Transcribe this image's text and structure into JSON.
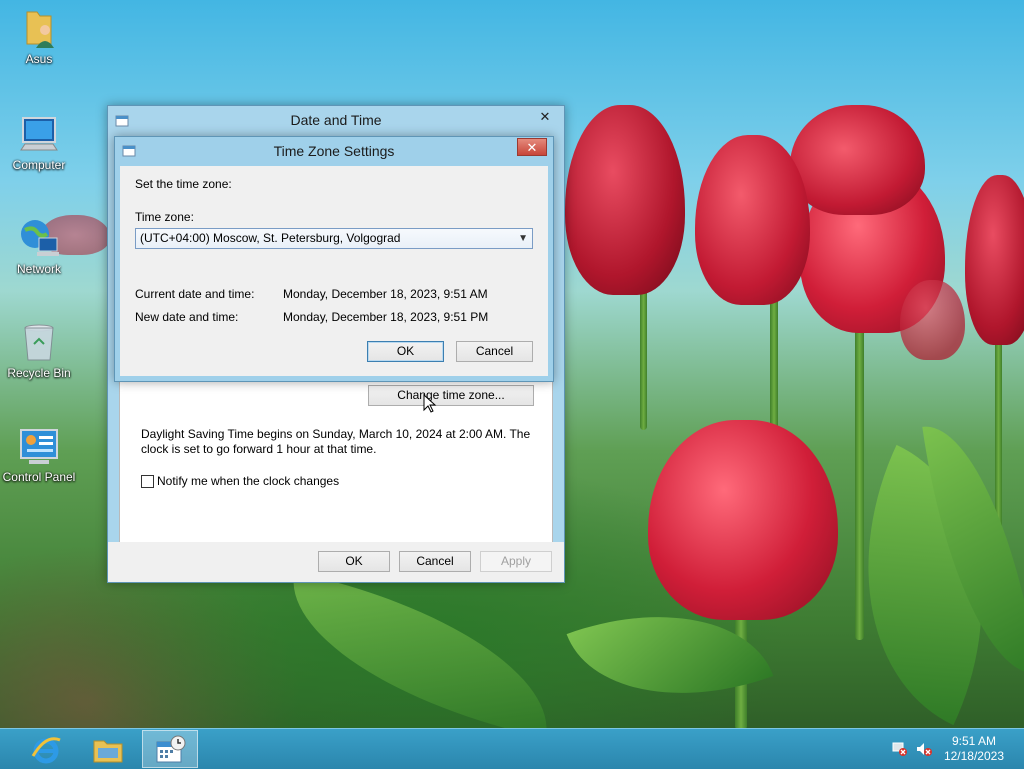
{
  "desktop": {
    "icons": [
      {
        "label": "Asus"
      },
      {
        "label": "Computer"
      },
      {
        "label": "Network"
      },
      {
        "label": "Recycle Bin"
      },
      {
        "label": "Control Panel"
      }
    ]
  },
  "date_time_window": {
    "title": "Date and Time",
    "close_glyph": "✕",
    "change_tz_button": "Change time zone...",
    "dst_line1": "Daylight Saving Time begins on Sunday, March 10, 2024 at 2:00 AM. The",
    "dst_line2": "clock is set to go forward 1 hour at that time.",
    "notify_label": "Notify me when the clock changes",
    "notify_checked": false,
    "ok_label": "OK",
    "cancel_label": "Cancel",
    "apply_label": "Apply"
  },
  "tz_dialog": {
    "title": "Time Zone Settings",
    "close_glyph": "✕",
    "set_label": "Set the time zone:",
    "tz_label": "Time zone:",
    "tz_value": "(UTC+04:00) Moscow, St. Petersburg, Volgograd",
    "current_label": "Current date and time:",
    "current_value": "Monday, December 18, 2023, 9:51 AM",
    "new_label": "New date and time:",
    "new_value": "Monday, December 18, 2023, 9:51 PM",
    "ok_label": "OK",
    "cancel_label": "Cancel"
  },
  "taskbar": {
    "items": [
      "internet-explorer-icon",
      "file-explorer-icon",
      "date-and-time-icon"
    ],
    "time": "9:51 AM",
    "date": "12/18/2023"
  },
  "colors": {
    "taskbar": "#2b86ad",
    "window_frame": "#a9d5ec",
    "close_red": "#c7463a"
  }
}
